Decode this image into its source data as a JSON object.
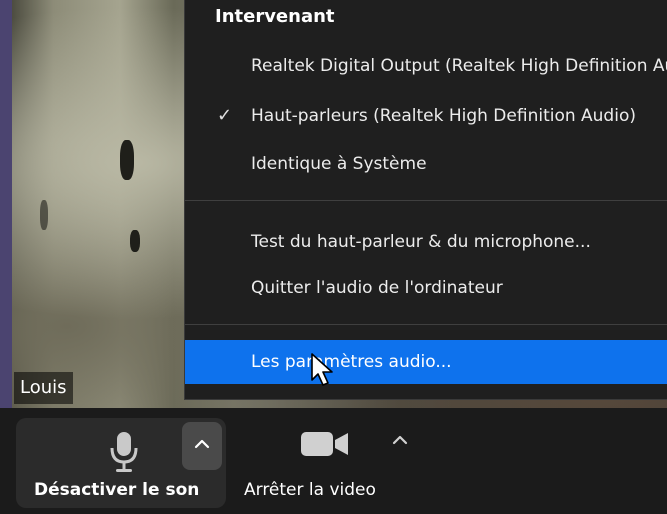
{
  "participant": {
    "name": "Louis"
  },
  "menu": {
    "header": "Intervenant",
    "items": [
      {
        "label": "Realtek Digital Output (Realtek High Definition Audio)",
        "checked": false
      },
      {
        "label": "Haut-parleurs (Realtek High Definition Audio)",
        "checked": true
      },
      {
        "label": "Identique à Système",
        "checked": false
      },
      {
        "label": "Test du haut-parleur & du microphone...",
        "checked": false
      },
      {
        "label": "Quitter l'audio de l'ordinateur",
        "checked": false
      },
      {
        "label": "Les paramètres audio...",
        "checked": false,
        "highlighted": true
      }
    ],
    "check_glyph": "✓"
  },
  "toolbar": {
    "mute_label": "Désactiver le son",
    "video_label": "Arrêter la video"
  },
  "colors": {
    "highlight": "#0e72ed",
    "menu_bg": "#1f1f1f",
    "toolbar_bg": "#1b1b1b"
  }
}
